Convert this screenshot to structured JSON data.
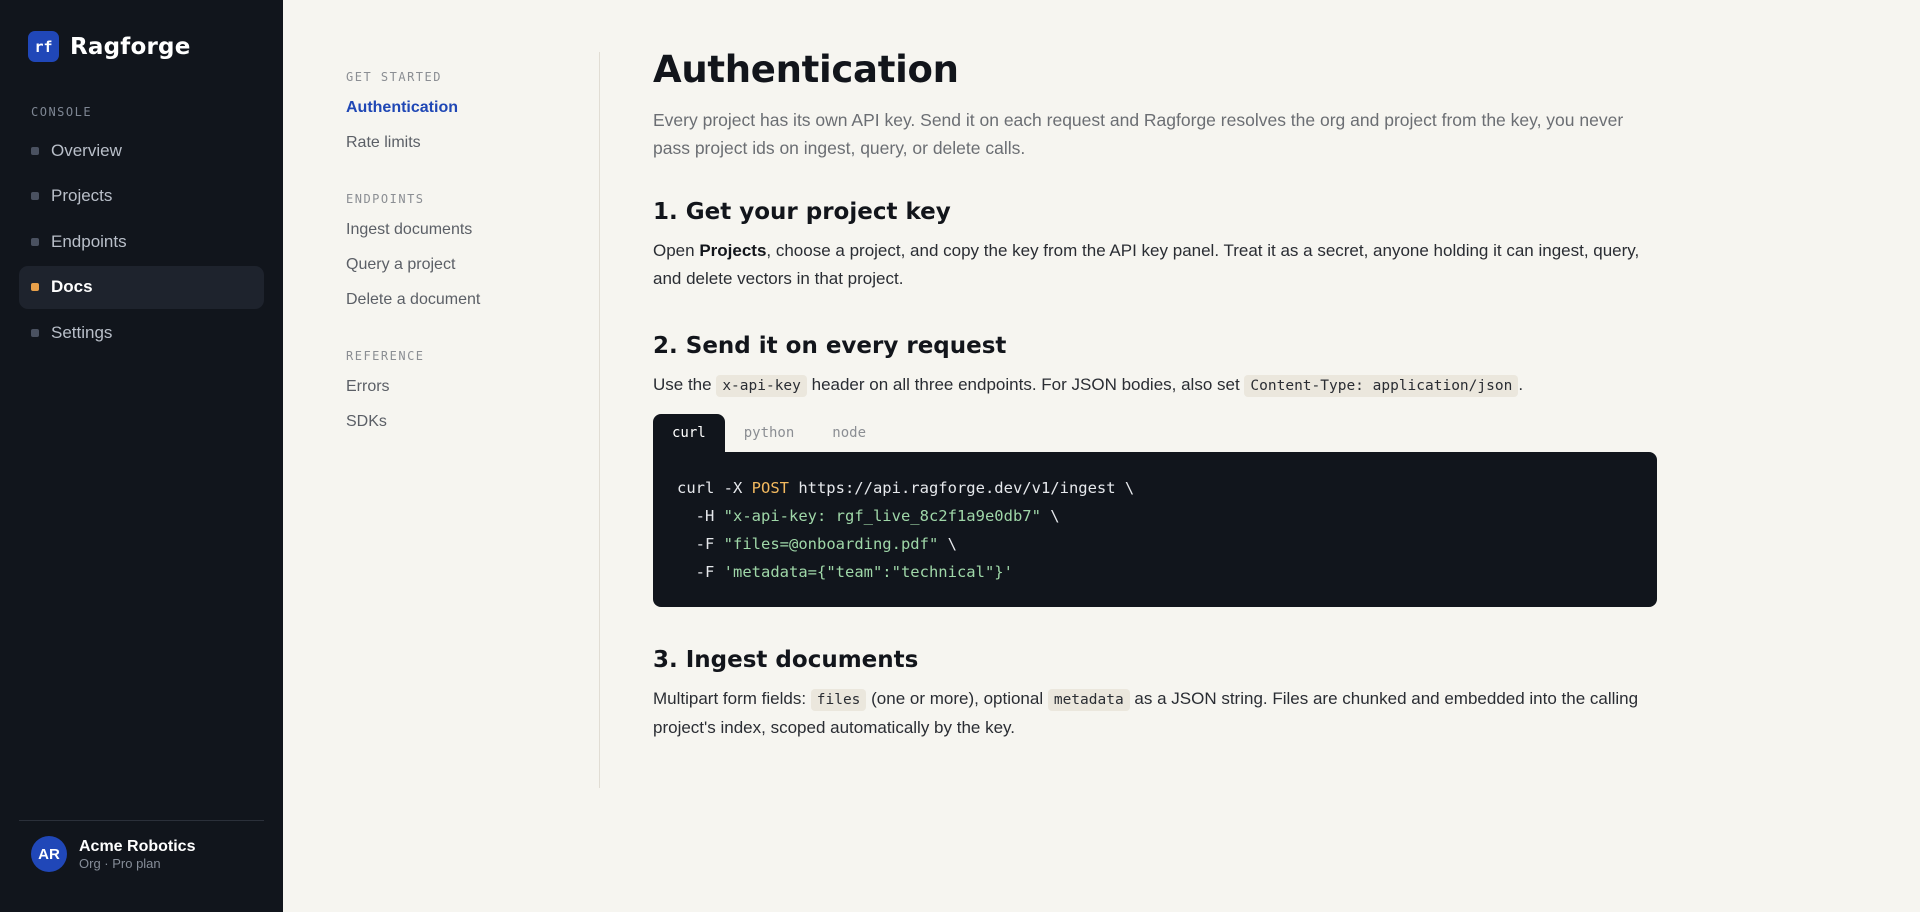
{
  "app": {
    "logo_text": "rf",
    "name": "Ragforge"
  },
  "sidebar": {
    "section_label": "CONSOLE",
    "items": [
      {
        "label": "Overview"
      },
      {
        "label": "Projects"
      },
      {
        "label": "Endpoints"
      },
      {
        "label": "Docs",
        "active": true
      },
      {
        "label": "Settings"
      }
    ],
    "account": {
      "initials": "AR",
      "name": "Acme Robotics",
      "subtitle": "Org · Pro plan"
    }
  },
  "docnav": {
    "sections": [
      {
        "label": "GET STARTED",
        "items": [
          "Authentication",
          "Rate limits"
        ]
      },
      {
        "label": "ENDPOINTS",
        "items": [
          "Ingest documents",
          "Query a project",
          "Delete a document"
        ]
      },
      {
        "label": "REFERENCE",
        "items": [
          "Errors",
          "SDKs"
        ]
      }
    ],
    "active_item": "Authentication"
  },
  "content": {
    "title": "Authentication",
    "lead": "Every project has its own API key. Send it on each request and Ragforge resolves the org and project from the key, you never pass project ids on ingest, query, or delete calls.",
    "step1": {
      "heading": "1. Get your project key",
      "text_before": "Open ",
      "bold": "Projects",
      "text_after": ", choose a project, and copy the key from the API key panel. Treat it as a secret, anyone holding it can ingest, query, and delete vectors in that project."
    },
    "step2": {
      "heading": "2. Send it on every request",
      "text_1": "Use the ",
      "code_1": "x-api-key",
      "text_2": " header on all three endpoints. For JSON bodies, also set ",
      "code_2": "Content-Type: application/json",
      "text_3": "."
    },
    "code_tabs": [
      "curl",
      "python",
      "node"
    ],
    "active_tab": "curl",
    "code": {
      "l1_a": "curl -X ",
      "l1_kw": "POST",
      "l1_b": " https://api.ragforge.dev/v1/ingest \\",
      "l2_a": "  -H ",
      "l2_str": "\"x-api-key: rgf_live_8c2f1a9e0db7\"",
      "l2_b": " \\",
      "l3_a": "  -F ",
      "l3_str": "\"files=@onboarding.pdf\"",
      "l3_b": " \\",
      "l4_a": "  -F ",
      "l4_str": "'metadata={\"team\":\"technical\"}'"
    },
    "step3": {
      "heading": "3. Ingest documents",
      "text_1": "Multipart form fields: ",
      "code_1": "files",
      "text_2": " (one or more), optional ",
      "code_2": "metadata",
      "text_3": " as a JSON string. Files are chunked and embedded into the calling project's index, scoped automatically by the key."
    }
  },
  "colors": {
    "sidebar_bg": "#11151c",
    "page_bg": "#f6f5f0",
    "accent": "#2047b8",
    "active_dot": "#e8a04a",
    "code_keyword": "#f3b95f",
    "code_string": "#9fd7a8"
  }
}
